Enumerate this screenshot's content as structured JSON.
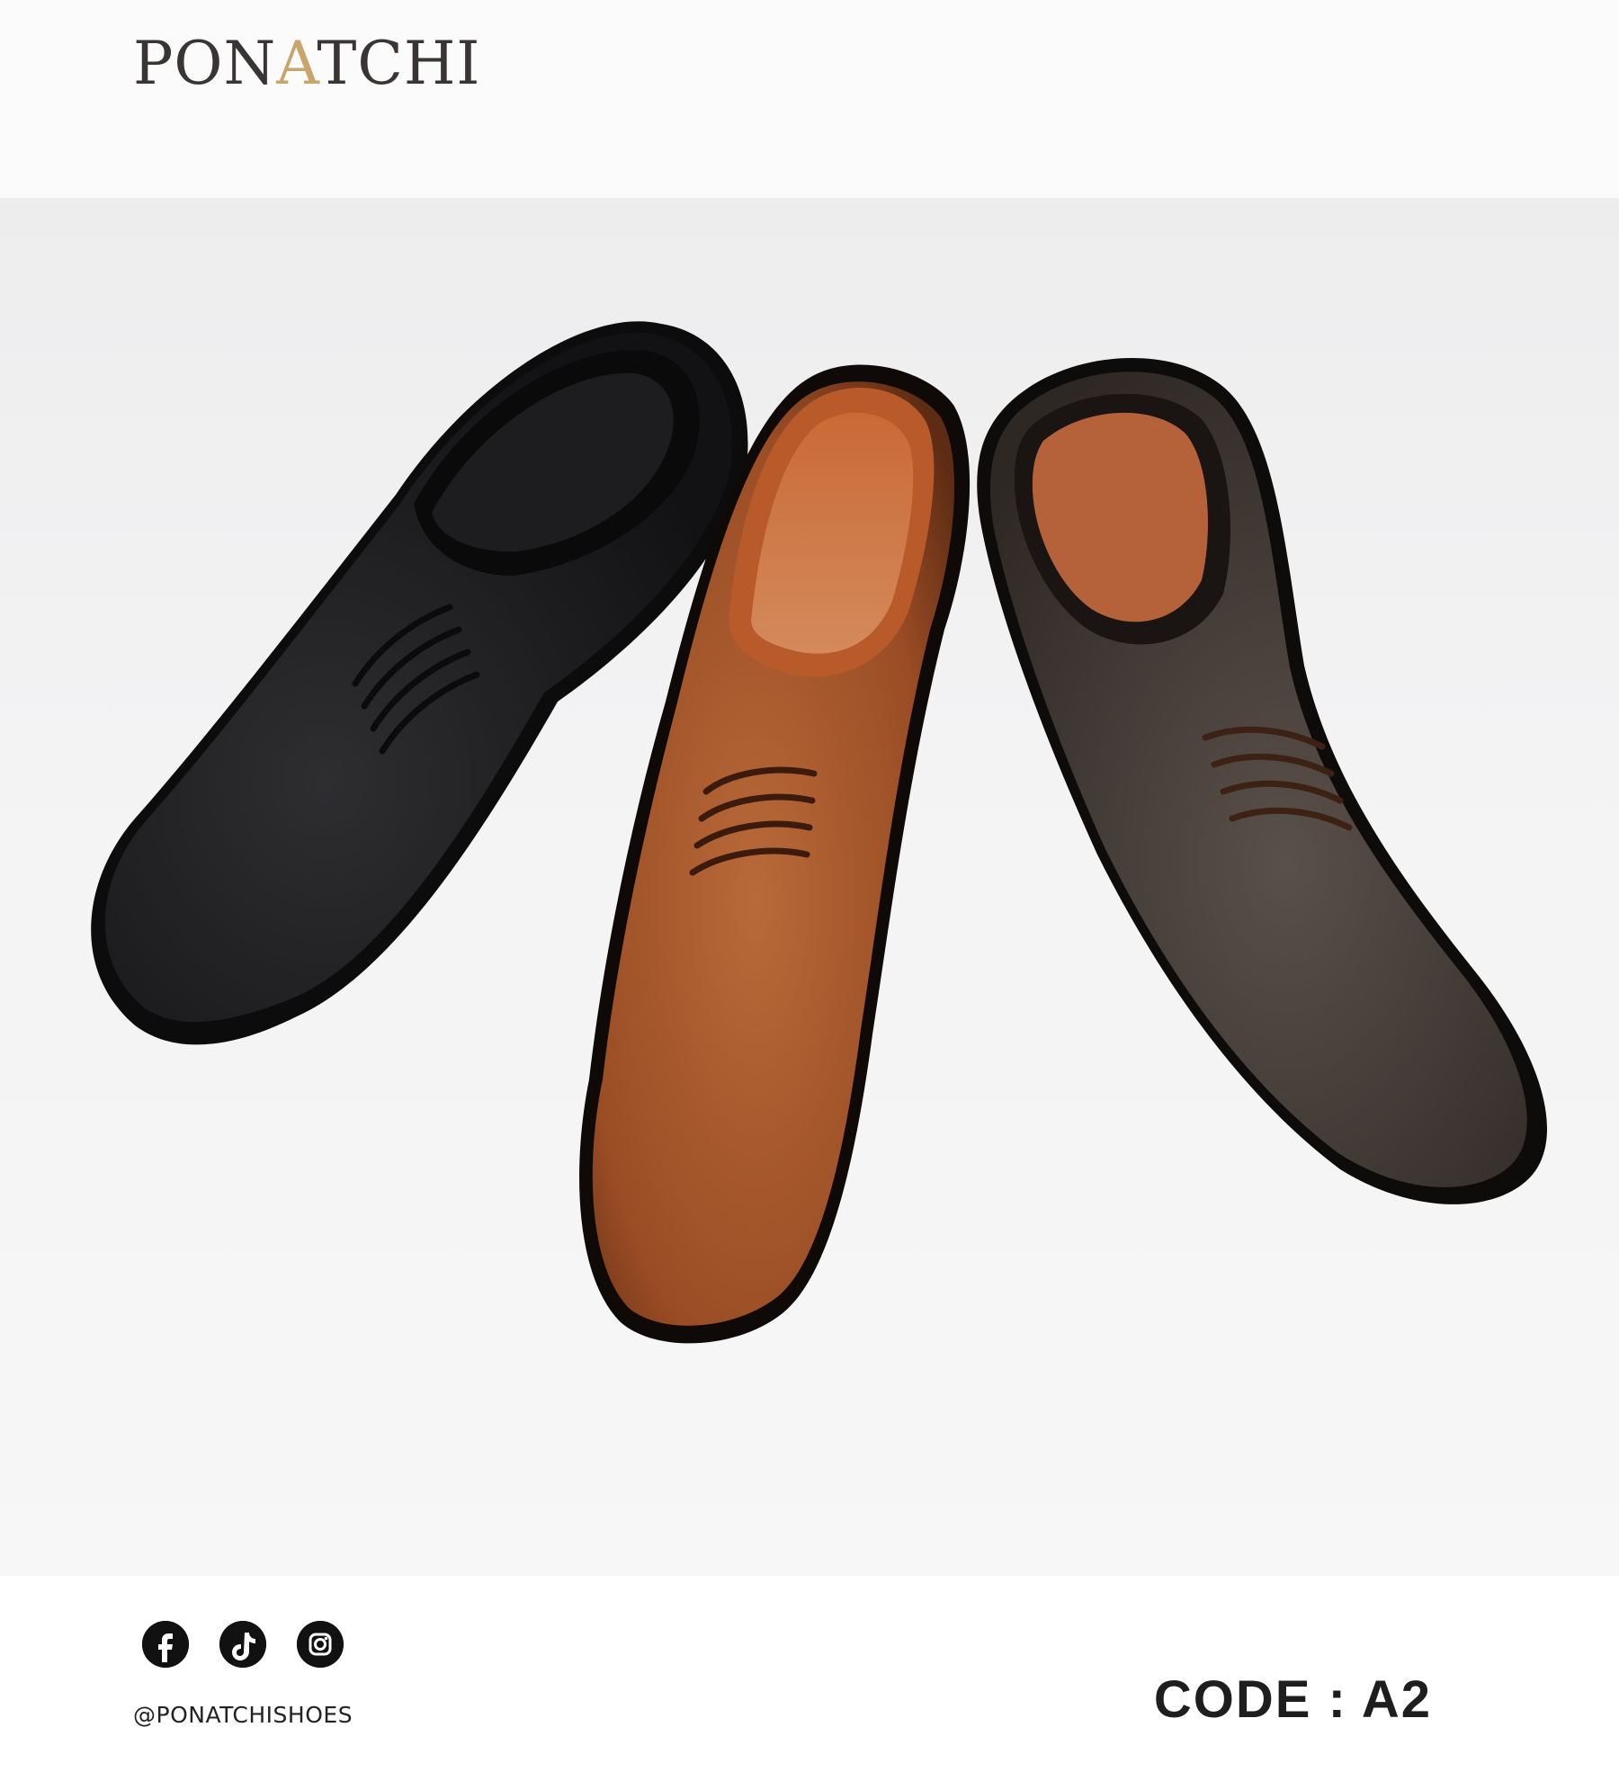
{
  "brand": {
    "logo_text": "PONATCHI"
  },
  "product": {
    "image_alt": "Three leather derby shoes in black, tan and dark brown",
    "shoe_colors": {
      "black": "#1c1c1e",
      "tan": "#a4522a",
      "brown": "#4a403b",
      "lining": "#c4784c"
    }
  },
  "footer": {
    "social_icons": [
      "facebook-icon",
      "tiktok-icon",
      "instagram-icon"
    ],
    "handle": "@PONATCHISHOES",
    "code_text": "CODE : A2"
  }
}
